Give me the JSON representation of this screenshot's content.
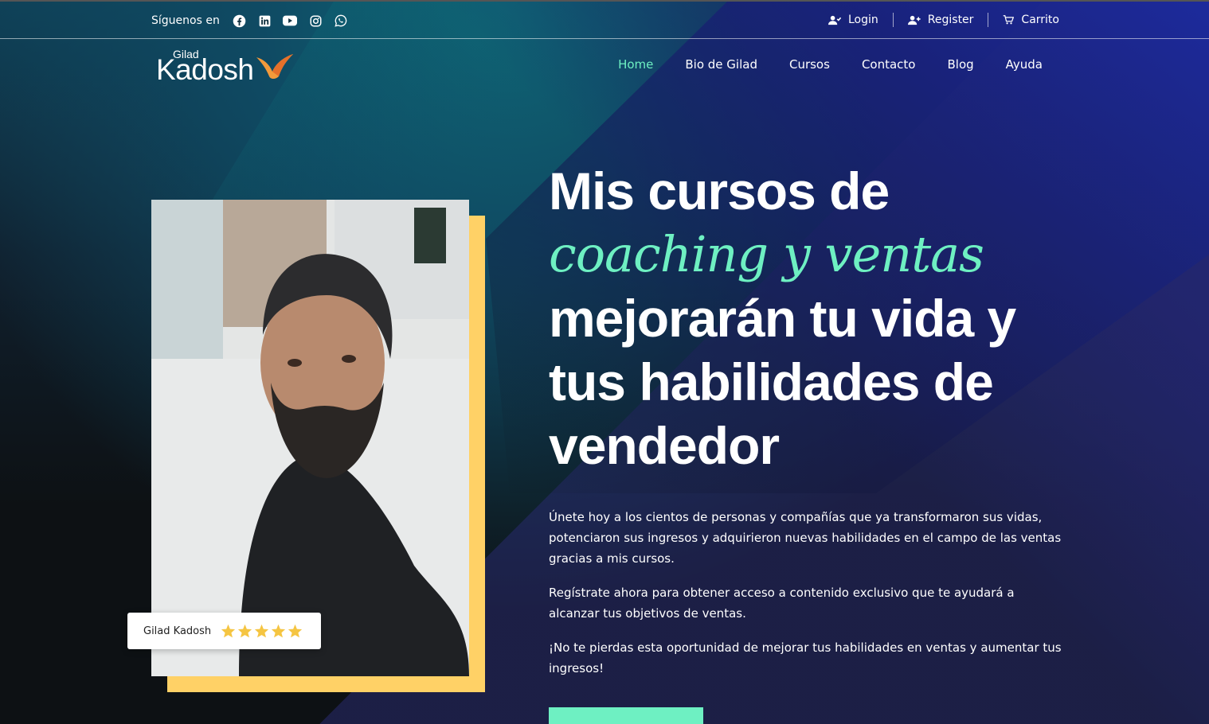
{
  "topbar": {
    "follow_label": "Síguenos en",
    "socials": [
      "facebook-icon",
      "linkedin-icon",
      "youtube-icon",
      "instagram-icon",
      "whatsapp-icon"
    ],
    "login": "Login",
    "register": "Register",
    "cart": "Carrito"
  },
  "logo": {
    "small": "Gilad",
    "big": "Kadosh"
  },
  "nav": {
    "items": [
      {
        "label": "Home",
        "active": true
      },
      {
        "label": "Bio de Gilad"
      },
      {
        "label": "Cursos"
      },
      {
        "label": "Contacto"
      },
      {
        "label": "Blog"
      },
      {
        "label": "Ayuda"
      }
    ]
  },
  "hero": {
    "title_line1": "Mis cursos de",
    "title_accent": "coaching y ventas",
    "title_line3": "mejorarán tu vida y",
    "title_line4": "tus habilidades de",
    "title_line5": "vendedor",
    "paragraphs": [
      "Únete hoy a los cientos de personas y compañías que ya transformaron sus vidas, potenciaron sus ingresos y adquirieron nuevas habilidades en el campo de las ventas gracias a mis cursos.",
      "Regístrate ahora para obtener acceso a contenido exclusivo que te ayudará a alcanzar tus objetivos de ventas.",
      "¡No te pierdas esta oportunidad de mejorar tus habilidades en ventas y aumentar tus ingresos!"
    ]
  },
  "rating_card": {
    "name": "Gilad Kadosh",
    "stars": 5
  },
  "colors": {
    "accent": "#6ef0c2",
    "frame": "#ffd166",
    "star": "#f5c542"
  }
}
